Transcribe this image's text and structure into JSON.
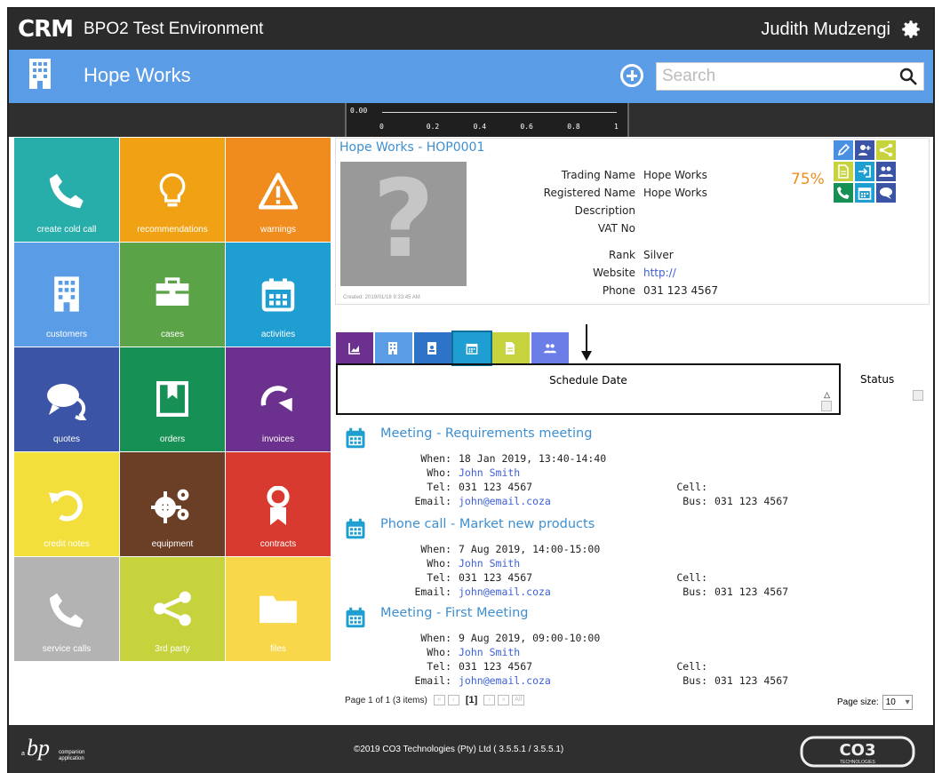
{
  "app": {
    "logo": "CRM",
    "title": "BPO2 Test Environment",
    "user": "Judith Mudzengi"
  },
  "header": {
    "company": "Hope Works",
    "search_placeholder": "Search"
  },
  "gauge": {
    "zero": "0.00",
    "ticks": [
      "0",
      "0.2",
      "0.4",
      "0.6",
      "0.8",
      "1"
    ]
  },
  "tiles": [
    {
      "label": "create cold call",
      "color": "#27aeaa",
      "icon": "phone-icon"
    },
    {
      "label": "recommendations",
      "color": "#f0a214",
      "icon": "lightbulb-icon"
    },
    {
      "label": "warnings",
      "color": "#f08c1e",
      "icon": "warning-icon"
    },
    {
      "label": "customers",
      "color": "#5b9ce6",
      "icon": "building-icon"
    },
    {
      "label": "cases",
      "color": "#5aa346",
      "icon": "briefcase-icon"
    },
    {
      "label": "activities",
      "color": "#1f9fd1",
      "icon": "calendar-icon"
    },
    {
      "label": "quotes",
      "color": "#3b54a6",
      "icon": "chat-icon"
    },
    {
      "label": "orders",
      "color": "#179055",
      "icon": "bookmark-icon"
    },
    {
      "label": "invoices",
      "color": "#6c318f",
      "icon": "redo-icon"
    },
    {
      "label": "credit notes",
      "color": "#f2df3c",
      "icon": "undo-icon"
    },
    {
      "label": "equipment",
      "color": "#6b3e26",
      "icon": "gears-icon"
    },
    {
      "label": "contracts",
      "color": "#d93a2f",
      "icon": "ribbon-icon"
    },
    {
      "label": "service calls",
      "color": "#b3b3b3",
      "icon": "phone-icon"
    },
    {
      "label": "3rd party",
      "color": "#c7d33c",
      "icon": "share-icon"
    },
    {
      "label": "files",
      "color": "#f8d84a",
      "icon": "folder-icon"
    }
  ],
  "card": {
    "title": "Hope Works - HOP0001",
    "created": "Created: 2019/01/18 9:33:45 AM",
    "percent": "75%",
    "fields": [
      {
        "label": "Trading Name",
        "value": "Hope Works"
      },
      {
        "label": "Registered Name",
        "value": "Hope Works"
      },
      {
        "label": "Description",
        "value": ""
      },
      {
        "label": "VAT No",
        "value": ""
      },
      {
        "label": "Rank",
        "value": "Silver"
      },
      {
        "label": "Website",
        "value": "http://"
      },
      {
        "label": "Phone",
        "value": "031 123 4567"
      }
    ]
  },
  "tabs": [
    {
      "name": "tab-chart",
      "color": "#6c318f"
    },
    {
      "name": "tab-customers",
      "color": "#5b9ce6"
    },
    {
      "name": "tab-contacts",
      "color": "#2d74c9"
    },
    {
      "name": "tab-activities",
      "color": "#1f9fd1"
    },
    {
      "name": "tab-documents",
      "color": "#c7d33c"
    },
    {
      "name": "tab-users",
      "color": "#6b7ee8"
    }
  ],
  "grid": {
    "schedule_header": "Schedule Date",
    "status_header": "Status",
    "sort_indicator": "△"
  },
  "activities": [
    {
      "title": "Meeting - Requirements meeting",
      "when": "18 Jan 2019, 13:40-14:40",
      "who": "John Smith",
      "tel": "031 123 4567",
      "email": "john@email.coza",
      "cell": "",
      "bus": "031 123 4567"
    },
    {
      "title": "Phone call - Market new products",
      "when": "7 Aug 2019, 14:00-15:00",
      "who": "John Smith",
      "tel": "031 123 4567",
      "email": "john@email.coza",
      "cell": "",
      "bus": "031 123 4567"
    },
    {
      "title": "Meeting - First Meeting",
      "when": "9 Aug 2019, 09:00-10:00",
      "who": "John Smith",
      "tel": "031 123 4567",
      "email": "john@email.coza",
      "cell": "",
      "bus": "031 123 4567"
    }
  ],
  "labels": {
    "when": "When:",
    "who": "Who:",
    "tel": "Tel:",
    "email": "Email:",
    "cell": "Cell:",
    "bus": "Bus:"
  },
  "pager": {
    "summary": "Page 1 of 1 (3 items)",
    "current": "[1]",
    "all": "All",
    "page_size_label": "Page size:",
    "page_size": "10"
  },
  "footer": {
    "bp_a": "a",
    "bp_companion": "companion",
    "bp_application": "application",
    "copyright": "©2019 CO3 Technologies (Pty) Ltd ( 3.5.5.1 / 3.5.5.1)",
    "co3_logo": "CO3",
    "co3_tag": "TECHNOLOGIES"
  }
}
